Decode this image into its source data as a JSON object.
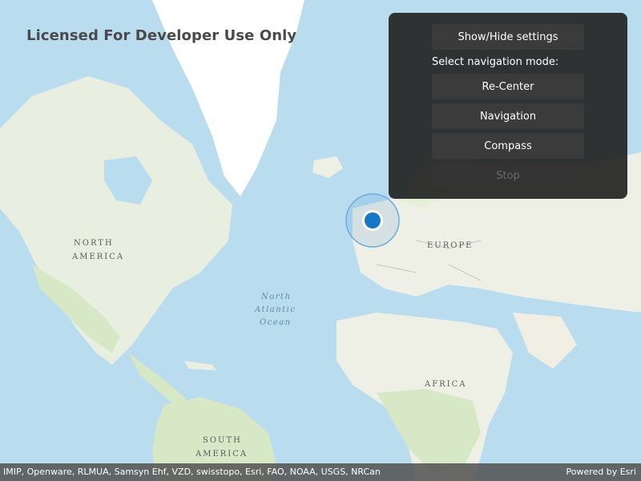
{
  "map": {
    "watermark": "Licensed For Developer Use Only",
    "labels": {
      "north_america_1": "NORTH",
      "north_america_2": "AMERICA",
      "europe": "EUROPE",
      "africa": "AFRICA",
      "south_america_1": "SOUTH",
      "south_america_2": "AMERICA",
      "ocean_1": "North",
      "ocean_2": "Atlantic",
      "ocean_3": "Ocean"
    },
    "colors": {
      "ocean": "#b9dcef",
      "land": "#eef0e6",
      "vegetation": "#d6e7c4",
      "ice": "#ffffff",
      "location": "#1677c9"
    }
  },
  "settings": {
    "toggle_label": "Show/Hide settings",
    "mode_label": "Select navigation mode:",
    "buttons": {
      "recenter": "Re-Center",
      "navigation": "Navigation",
      "compass": "Compass",
      "stop": "Stop"
    }
  },
  "attribution": {
    "sources": "IMIP, Openware, RLMUA, Samsyn Ehf, VZD, swisstopo, Esri, FAO, NOAA, USGS, NRCan",
    "powered_by": "Powered by Esri"
  }
}
